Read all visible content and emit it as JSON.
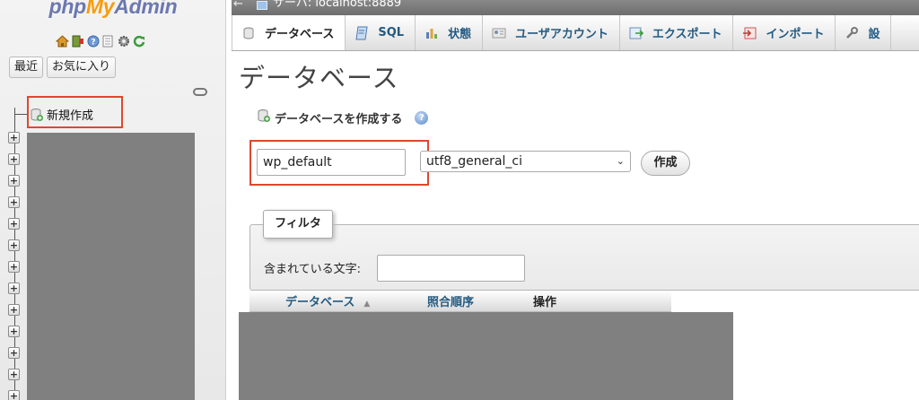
{
  "navigation": {
    "logo": {
      "part1": "php",
      "part2": "My",
      "part3": "Admin"
    },
    "icons": [
      "home-icon",
      "exit-icon",
      "help-icon",
      "docs-icon",
      "settings-icon",
      "reload-icon"
    ],
    "recent_label": "最近",
    "favorites_label": "お気に入り",
    "new_db_label": "新規作成",
    "expander_symbol": "+"
  },
  "server_bar": {
    "back_symbol": "←",
    "text": "サーバ:  localhost:8889"
  },
  "tabs": [
    {
      "label": "データベース",
      "icon": "database-icon",
      "active": true
    },
    {
      "label": "SQL",
      "icon": "sql-icon"
    },
    {
      "label": "状態",
      "icon": "status-icon"
    },
    {
      "label": "ユーザアカウント",
      "icon": "users-icon"
    },
    {
      "label": "エクスポート",
      "icon": "export-icon"
    },
    {
      "label": "インポート",
      "icon": "import-icon"
    },
    {
      "label": "設",
      "icon": "wrench-icon"
    }
  ],
  "main": {
    "title": "データベース",
    "create_heading": "データベースを作成する",
    "help_symbol": "?",
    "db_name_value": "wp_default",
    "collation_value": "utf8_general_ci",
    "chevron": "⌄",
    "create_button": "作成"
  },
  "filter": {
    "legend": "フィルタ",
    "label": "含まれている文字:",
    "value": ""
  },
  "table": {
    "columns": [
      "データベース",
      "照合順序",
      "操作"
    ],
    "sort_symbol": "▲"
  },
  "colors": {
    "highlight": "#e0472e",
    "link": "#235a81",
    "logo_blue": "#6c78af",
    "logo_orange": "#f89c0e",
    "redacted": "#808080"
  }
}
